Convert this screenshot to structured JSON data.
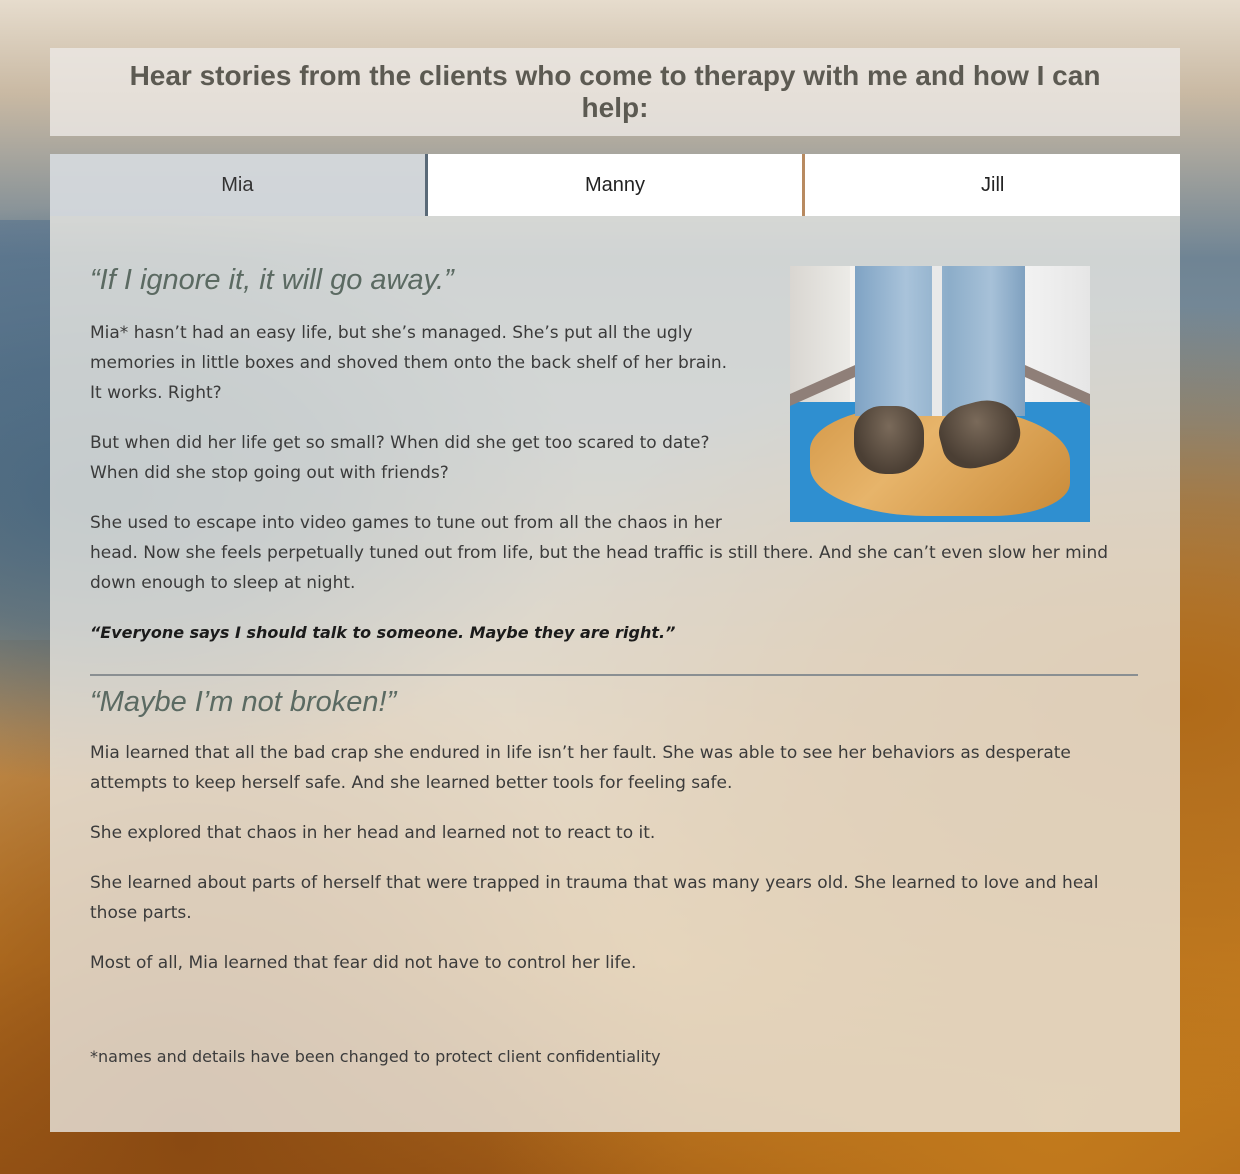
{
  "header": {
    "title": "Hear stories from the clients who come to therapy with me and how I can help:"
  },
  "tabs": [
    {
      "label": "Mia",
      "active": true
    },
    {
      "label": "Manny",
      "active": false
    },
    {
      "label": "Jill",
      "active": false
    }
  ],
  "story": {
    "image_icon": "person-standing-in-corner-photo",
    "section1": {
      "heading": "“If I ignore it, it will go away.”",
      "paragraphs": [
        "Mia* hasn’t had an easy life, but she’s managed. She’s put all the ugly memories in little boxes and shoved them onto the back shelf of her brain. It works. Right?",
        "But when did her life get so small? When did she get too scared to date? When did she stop going out with friends?",
        "She used to escape into video games to tune out from all the chaos in her head. Now she feels perpetually tuned out from life, but the head traffic is still there. And she can’t even slow her mind down enough to sleep at night."
      ],
      "emphasis": "“Everyone says I should talk to someone. Maybe they are right.”"
    },
    "section2": {
      "heading": "“Maybe I’m not broken!”",
      "paragraphs": [
        "Mia learned that all the bad crap she endured in life isn’t her fault. She was able to see her behaviors as desperate attempts to keep herself safe. And she learned better tools for feeling safe.",
        "She explored that chaos in her head and learned not to react to it.",
        "She learned about parts of herself that were trapped in trauma that was many years old. She learned to love and heal those parts.",
        "Most of all, Mia learned that fear did not have to control her life."
      ]
    },
    "footnote": "*names and details have been changed to protect client confidentiality"
  },
  "colors": {
    "heading_green": "#5b6a62",
    "header_text": "#5c5a52",
    "active_tab_border": "#5a6a78"
  }
}
